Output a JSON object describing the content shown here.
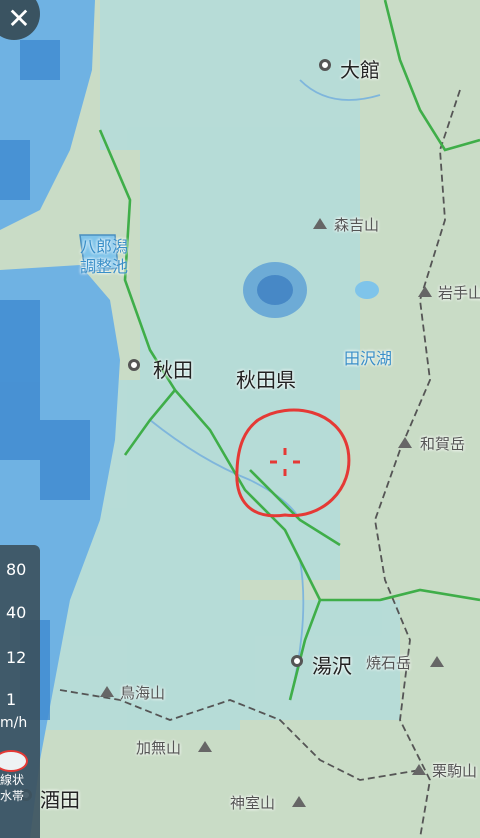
{
  "map": {
    "places": {
      "odate": "大館",
      "akita": "秋田",
      "akita_pref": "秋田県",
      "yuzawa": "湯沢",
      "sakata": "酒田"
    },
    "water": {
      "hachirogata_1": "八郎潟",
      "hachirogata_2": "調整池",
      "tazawako": "田沢湖"
    },
    "peaks": {
      "moriyoshi": "森吉山",
      "iwate": "岩手山",
      "waga": "和賀岳",
      "yakeishi": "焼石岳",
      "chokai": "鳥海山",
      "kamuro_1": "加無山",
      "kamuro_2": "神室山",
      "kurikoma": "栗駒山"
    }
  },
  "legend": {
    "values": [
      "80",
      "40",
      "12",
      "1"
    ],
    "unit": "m/h",
    "band_label_1": "線状",
    "band_label_2": "水帯"
  },
  "controls": {
    "close_glyph": "✕"
  },
  "colors": {
    "land": "#c9dcc6",
    "sea": "#5fa8de",
    "rain": "#8fd0e3",
    "rail": "#3fae49",
    "marker": "#e53935"
  }
}
